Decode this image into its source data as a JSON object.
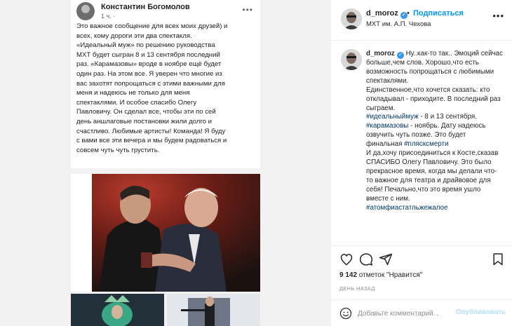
{
  "fb_post": {
    "author": "Константин Богомолов",
    "time": "1 ч. ·",
    "text": "Это важное сообщение для всех моих друзей) и\nвсех, кому дороги эти два спектакля.\n«Идеальный муж» по решению руководства\nМХТ будет сыгран 8 и 13 сентября последний\nраз. «Карамазовы» вроде в ноябре ещё будет\nодин раз. На этом все. Я уверен что многие из\nвас захотят попрощаться с этими важными для\nменя и надеюсь не только для меня\nспектаклями. И особое спасибо Олегу\nПавловичу. Он сделал все, чтобы эти по сей\nдень аншлаговые постановки жили долго и\nсчастливо. Любимые артисты! Команда! Я буду\nс вами все эти вечера и мы будем радоваться и\nсовсем чуть чуть грустить."
  },
  "header": {
    "username": "d_moroz",
    "separator": "•",
    "follow_label": "Подписаться",
    "location": "МХТ им. А.П. Чехова"
  },
  "caption": {
    "username": "d_moroz",
    "p1": "Ну..как-то так.. Эмоций сейчас больше,чем слов. Хорошо,что есть возможность попрощаться с любимыми спектаклями.",
    "p2_start": "Единственное,что хочется сказать: кто откладывал - приходите. В последний раз сыграем.",
    "tag1": "#идеальныймуж",
    "p2_mid1": " - 8 и 13 сентября.",
    "tag2": "#карамазовы",
    "p2_mid2": " - ноябрь. Дату надеюсь озвучить чуть позже. Это будет финальная ",
    "tag3": "#плясксмерти",
    "p3": "И да,хочу присоединиться к Косте,сказав СПАСИБО Олегу Павловичу. Это было прекрасное время, когда мы делали что-то важное для театра и драйвовое для себя! Печально,что это время ушло вместе с ним.",
    "tag4": "#атомфиастатльжежалое"
  },
  "likes": {
    "count": "9 142",
    "rest": " отметок \"Нравится\""
  },
  "date": "ДЕНЬ НАЗАД",
  "comment": {
    "placeholder": "Добавьте комментарий...",
    "publish_label": "Опубликовать"
  },
  "colors": {
    "link_blue": "#0095f6",
    "hashtag": "#00376b",
    "verified": "#3897f0",
    "muted": "#8e8e8e"
  },
  "icons": [
    "heart-icon",
    "comment-icon",
    "share-icon",
    "bookmark-icon",
    "emoji-icon",
    "more-icon",
    "verified-icon"
  ]
}
